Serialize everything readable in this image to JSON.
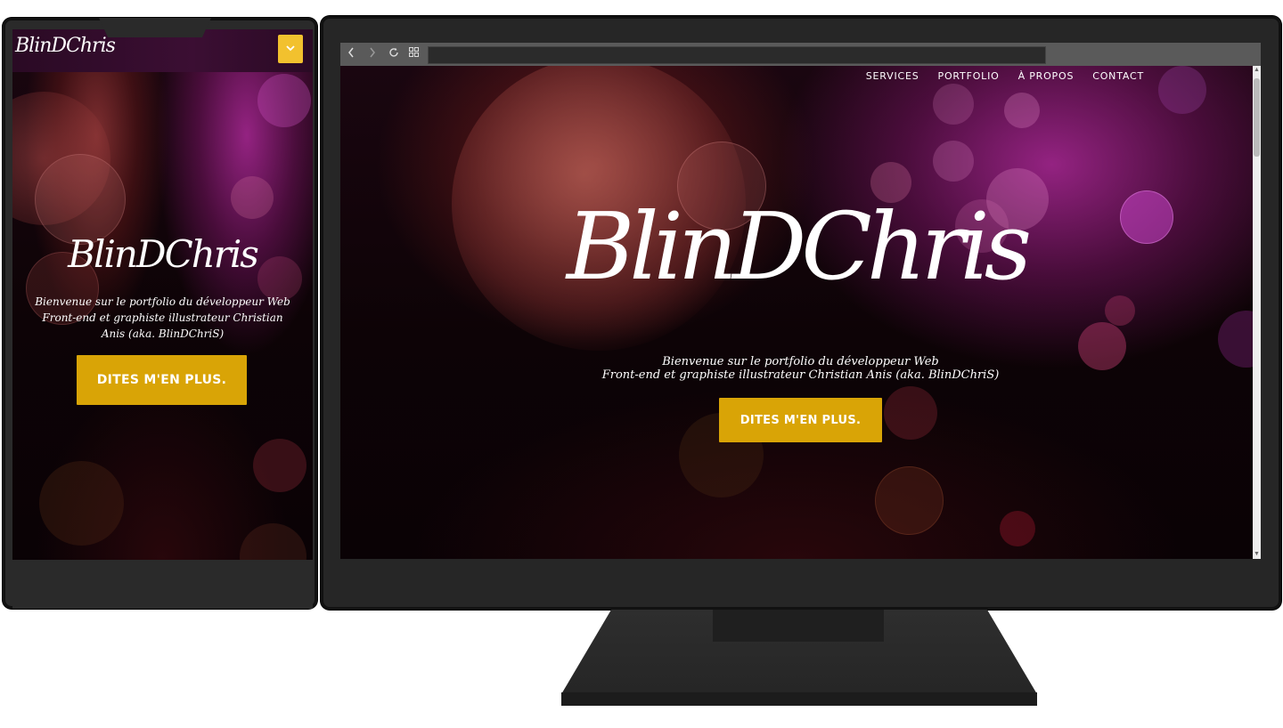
{
  "brand": {
    "logo": "BlinDChris",
    "accent_color": "#d9a406",
    "menu_button_color": "#f2c12e"
  },
  "phone": {
    "logo_small": "BlinDChris",
    "menu_icon": "chevron-down-icon",
    "logo_big": "BlinDChris",
    "tagline": "Bienvenue sur le portfolio du développeur Web Front-end et graphiste illustrateur Christian Anis (aka. BlinDChriS)",
    "cta_label": "DITES M'EN PLUS."
  },
  "browser": {
    "back_icon": "chevron-left-icon",
    "forward_icon": "chevron-right-icon",
    "reload_icon": "reload-icon",
    "apps_icon": "grid-icon",
    "url": ""
  },
  "desktop": {
    "nav": [
      "SERVICES",
      "PORTFOLIO",
      "À PROPOS",
      "CONTACT"
    ],
    "logo": "BlinDChris",
    "tagline_line1": "Bienvenue sur le portfolio du développeur Web",
    "tagline_line2": "Front-end et graphiste illustrateur Christian Anis (aka. BlinDChriS)",
    "cta_label": "DITES M'EN PLUS."
  }
}
